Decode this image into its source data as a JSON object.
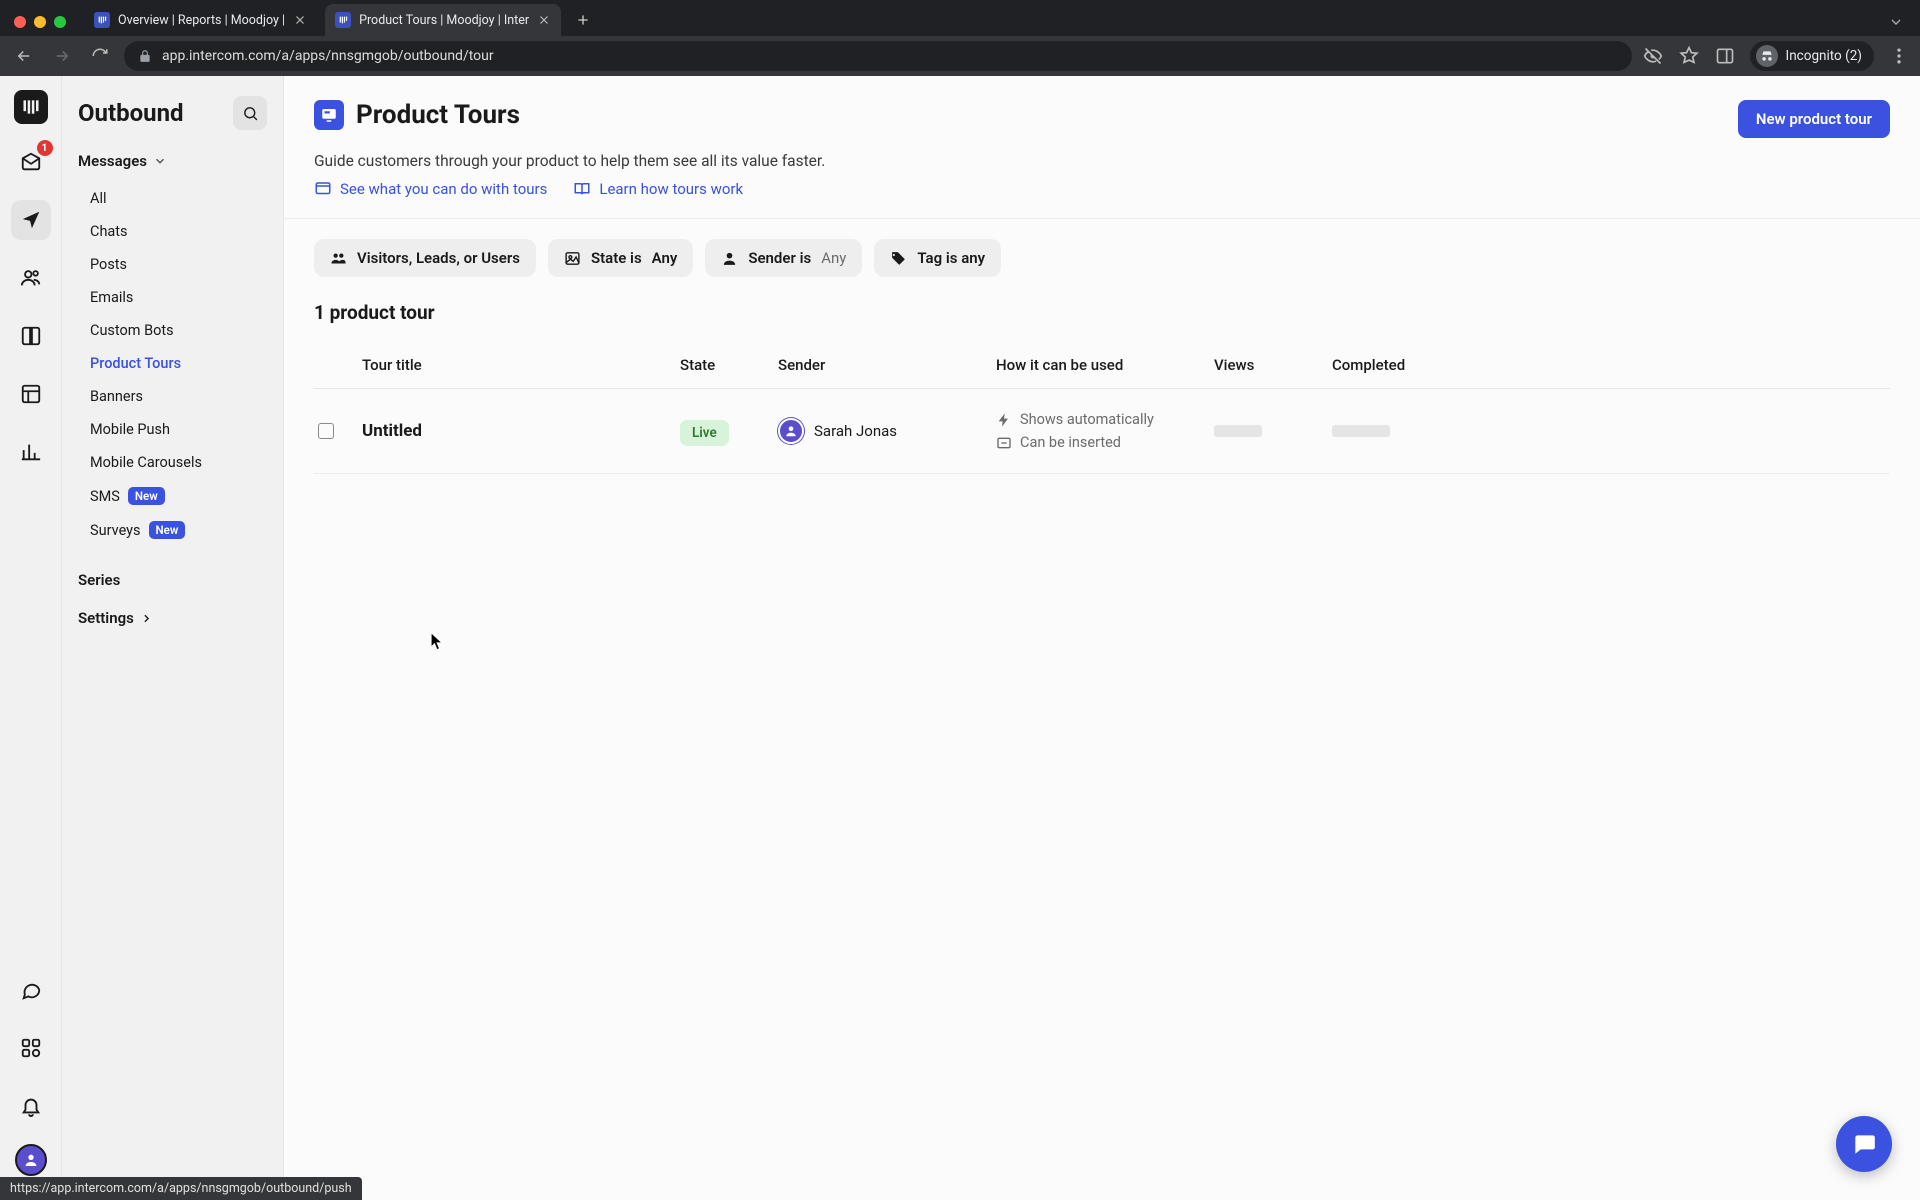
{
  "browser": {
    "tabs": [
      {
        "title": "Overview | Reports | Moodjoy |"
      },
      {
        "title": "Product Tours | Moodjoy | Inter"
      }
    ],
    "url": "app.intercom.com/a/apps/nnsgmgob/outbound/tour",
    "incognito_label": "Incognito (2)",
    "status_hint": "https://app.intercom.com/a/apps/nnsgmgob/outbound/push"
  },
  "rail": {
    "inbox_badge": "1"
  },
  "sidebar": {
    "title": "Outbound",
    "section_messages": "Messages",
    "items": {
      "all": "All",
      "chats": "Chats",
      "posts": "Posts",
      "emails": "Emails",
      "custom_bots": "Custom Bots",
      "product_tours": "Product Tours",
      "banners": "Banners",
      "mobile_push": "Mobile Push",
      "mobile_carousels": "Mobile Carousels",
      "sms": "SMS",
      "surveys": "Surveys"
    },
    "badge_new": "New",
    "series": "Series",
    "settings": "Settings"
  },
  "page": {
    "title": "Product Tours",
    "new_button": "New product tour",
    "subtitle": "Guide customers through your product to help them see all its value faster.",
    "help1": "See what you can do with tours",
    "help2": "Learn how tours work",
    "filters": {
      "audience_strong": "Visitors, Leads, or Users",
      "state_label": "State is",
      "state_value": "Any",
      "sender_label": "Sender is",
      "sender_value": "Any",
      "tag_strong": "Tag is any"
    },
    "count_header": "1 product tour",
    "columns": {
      "title": "Tour title",
      "state": "State",
      "sender": "Sender",
      "usage": "How it can be used",
      "views": "Views",
      "completed": "Completed"
    },
    "row": {
      "title": "Untitled",
      "state": "Live",
      "sender": "Sarah Jonas",
      "usage1": "Shows automatically",
      "usage2": "Can be inserted"
    }
  }
}
